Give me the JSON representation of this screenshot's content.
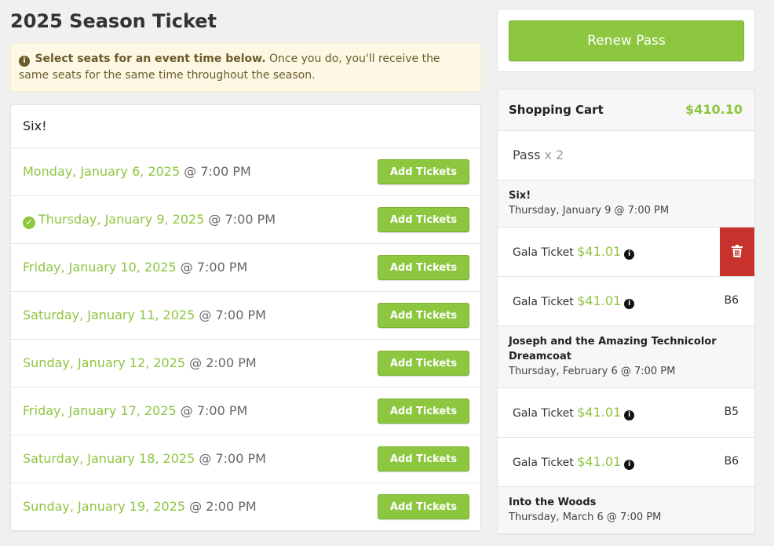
{
  "page": {
    "title": "2025 Season Ticket"
  },
  "notice": {
    "info_icon": "i",
    "bold_text": "Select seats for an event time below.",
    "text": " Once you do, you'll receive the same seats for the same time throughout the season."
  },
  "events": {
    "show_name": "Six!",
    "add_label": "Add Tickets",
    "check_icon": "✓",
    "rows": [
      {
        "date": "Monday, January 6, 2025",
        "time": " @ 7:00 PM",
        "selected": false
      },
      {
        "date": "Thursday, January 9, 2025",
        "time": " @ 7:00 PM",
        "selected": true
      },
      {
        "date": "Friday, January 10, 2025",
        "time": " @ 7:00 PM",
        "selected": false
      },
      {
        "date": "Saturday, January 11, 2025",
        "time": " @ 7:00 PM",
        "selected": false
      },
      {
        "date": "Sunday, January 12, 2025",
        "time": " @ 2:00 PM",
        "selected": false
      },
      {
        "date": "Friday, January 17, 2025",
        "time": " @ 7:00 PM",
        "selected": false
      },
      {
        "date": "Saturday, January 18, 2025",
        "time": " @ 7:00 PM",
        "selected": false
      },
      {
        "date": "Sunday, January 19, 2025",
        "time": " @ 2:00 PM",
        "selected": false
      }
    ]
  },
  "renew": {
    "label": "Renew Pass"
  },
  "cart": {
    "title": "Shopping Cart",
    "total": "$410.10",
    "pass": {
      "label": "Pass",
      "qty": " x 2"
    },
    "info_icon": "i",
    "trash_icon": "trash-icon",
    "shows": [
      {
        "name": "Six!",
        "time": "Thursday, January 9 @ 7:00 PM",
        "tickets": [
          {
            "label": "Gala Ticket",
            "price": "$41.01",
            "seat": "",
            "delete": true
          },
          {
            "label": "Gala Ticket",
            "price": "$41.01",
            "seat": "B6",
            "delete": false
          }
        ]
      },
      {
        "name": "Joseph and the Amazing Technicolor Dreamcoat",
        "time": "Thursday, February 6 @ 7:00 PM",
        "tickets": [
          {
            "label": "Gala Ticket",
            "price": "$41.01",
            "seat": "B5",
            "delete": false
          },
          {
            "label": "Gala Ticket",
            "price": "$41.01",
            "seat": "B6",
            "delete": false
          }
        ]
      },
      {
        "name": "Into the Woods",
        "time": "Thursday, March 6 @ 7:00 PM",
        "tickets": []
      }
    ]
  },
  "colors": {
    "accent": "#8dc63f",
    "danger": "#c8322c",
    "notice_bg": "#fcf8e3"
  }
}
